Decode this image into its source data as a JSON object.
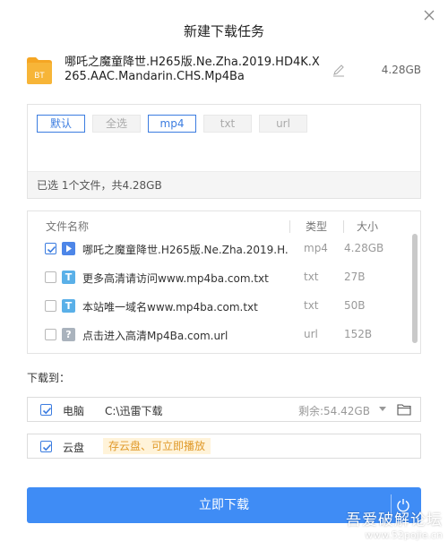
{
  "dialog": {
    "title": "新建下载任务"
  },
  "file": {
    "name": "哪吒之魔童降世.H265版.Ne.Zha.2019.HD4K.X265.AAC.Mandarin.CHS.Mp4Ba",
    "size": "4.28GB",
    "icon_label": "BT"
  },
  "filter": {
    "chips": [
      "默认",
      "全选",
      "mp4",
      "txt",
      "url"
    ],
    "summary": "已选 1个文件，共4.28GB"
  },
  "list": {
    "columns": {
      "name": "文件名称",
      "type": "类型",
      "size": "大小"
    },
    "rows": [
      {
        "name": "哪吒之魔童降世.H265版.Ne.Zha.2019.H...",
        "type": "mp4",
        "size": "4.28GB",
        "checked": true,
        "icon": "video-icon"
      },
      {
        "name": "更多高清请访问www.mp4ba.com.txt",
        "type": "txt",
        "size": "27B",
        "checked": false,
        "icon": "text-file-icon"
      },
      {
        "name": "本站唯一域名www.mp4ba.com.txt",
        "type": "txt",
        "size": "50B",
        "checked": false,
        "icon": "text-file-icon"
      },
      {
        "name": "点击进入高清Mp4Ba.com.url",
        "type": "url",
        "size": "152B",
        "checked": false,
        "icon": "unknown-file-icon"
      }
    ]
  },
  "download_to": {
    "label": "下载到：",
    "pc": {
      "name": "电脑",
      "path": "C:\\迅雷下载",
      "space": "剩余:54.42GB",
      "checked": true
    },
    "cloud": {
      "name": "云盘",
      "tip": "存云盘、可立即播放",
      "checked": true
    }
  },
  "action": {
    "download_label": "立即下载"
  },
  "watermark": {
    "title": "吾爱破解论坛",
    "url": "www.52pojie.cn"
  },
  "colors": {
    "accent": "#3f8cf5",
    "link_blue": "#3b7ce0",
    "tip_bg": "#fff3d9",
    "tip_text": "#e09a2a"
  }
}
